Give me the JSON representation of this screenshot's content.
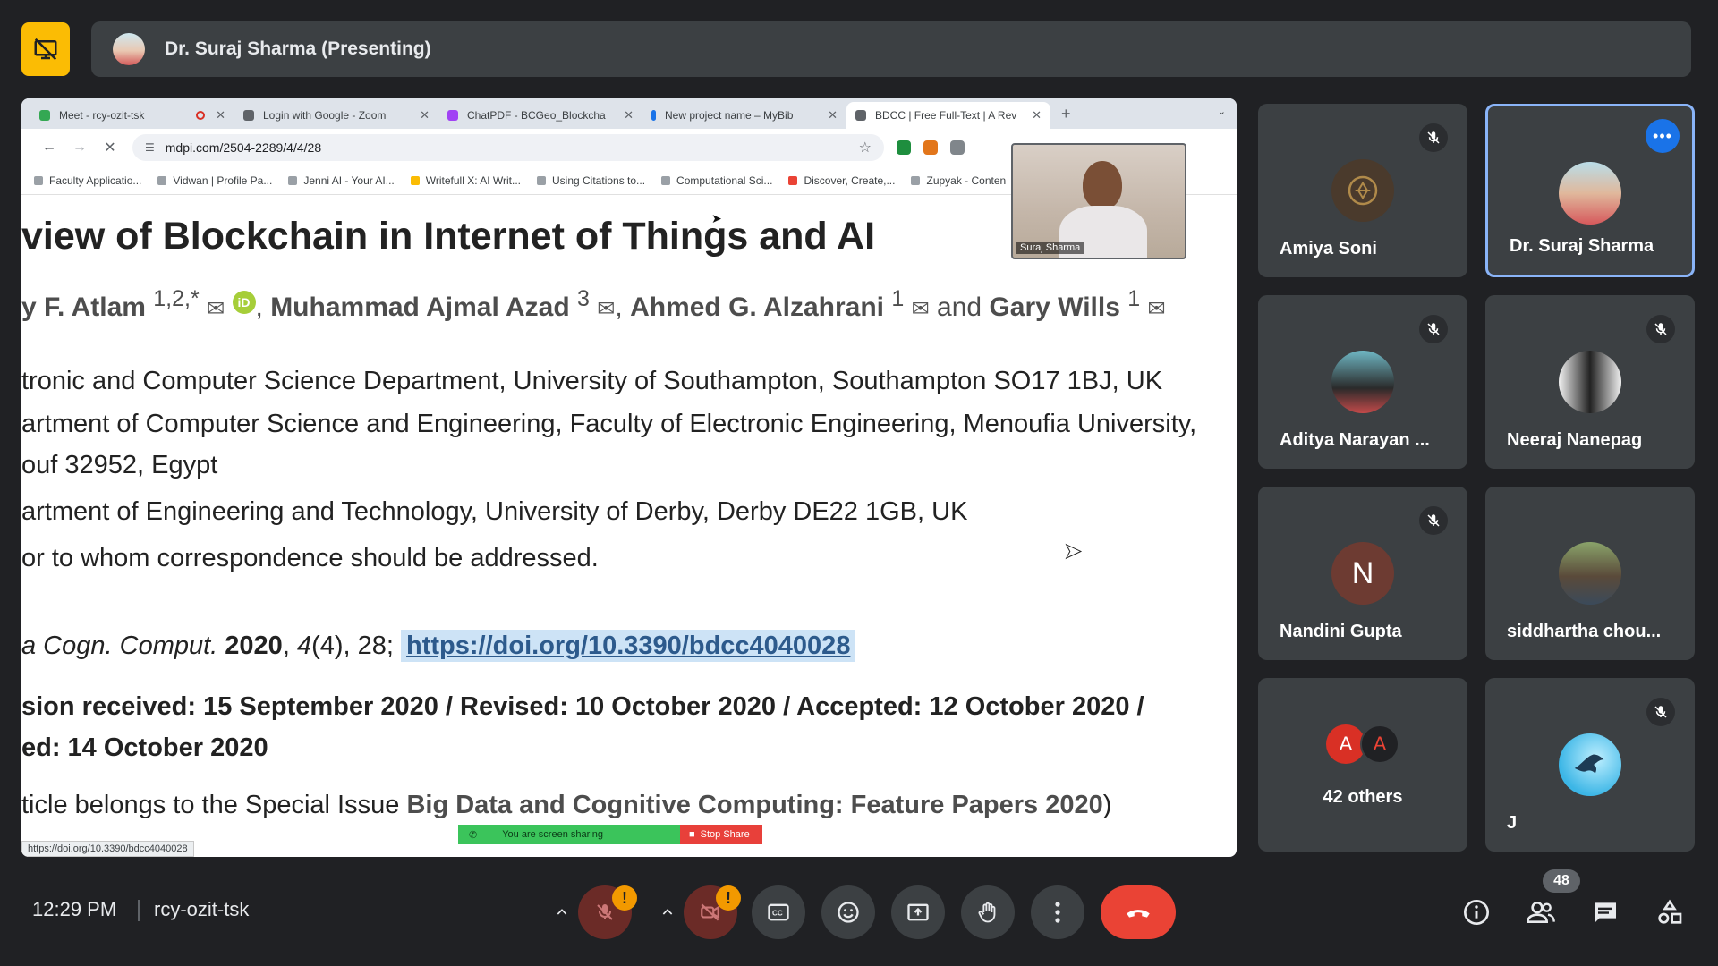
{
  "presenter": {
    "label": "Dr. Suraj Sharma (Presenting)"
  },
  "browser": {
    "tabs": [
      {
        "label": "Meet - rcy-ozit-tsk",
        "color": "#34a853"
      },
      {
        "label": "Login with Google - Zoom",
        "color": "#5f6368"
      },
      {
        "label": "ChatPDF - BCGeo_Blockcha",
        "color": "#a142f4"
      },
      {
        "label": "New project name – MyBib",
        "color": "#1a73e8"
      },
      {
        "label": "BDCC | Free Full-Text | A Rev",
        "color": "#5f6368"
      }
    ],
    "url": "mdpi.com/2504-2289/4/4/28",
    "bookmarks": [
      "Faculty Applicatio...",
      "Vidwan | Profile Pa...",
      "Jenni AI - Your AI...",
      "Writefull X: AI Writ...",
      "Using Citations to...",
      "Computational Sci...",
      "Discover, Create,...",
      "Zupyak - Conten"
    ],
    "status_url": "https://doi.org/10.3390/bdcc4040028",
    "sharing": {
      "message": "You are screen sharing",
      "stop_label": "Stop Share"
    }
  },
  "article": {
    "title": "view of Blockchain in Internet of Things and AI",
    "authors": {
      "a1": "y F. Atlam",
      "a1_sup": "1,2,*",
      "a2": "Muhammad Ajmal Azad",
      "a2_sup": "3",
      "a3": "Ahmed G. Alzahrani",
      "a3_sup": "1",
      "and": "and",
      "a4": "Gary Wills",
      "a4_sup": "1",
      "orcid": "iD"
    },
    "affiliations": [
      "tronic and Computer Science Department, University of Southampton, Southampton SO17 1BJ, UK",
      "artment of Computer Science and Engineering, Faculty of Electronic Engineering, Menoufia University,",
      "ouf 32952, Egypt",
      "artment of Engineering and Technology, University of Derby, Derby DE22 1GB, UK",
      "or to whom correspondence should be addressed."
    ],
    "citation": {
      "journal": "a Cogn. Comput.",
      "year": "2020",
      "volume": "4",
      "issue_pages": "(4), 28;",
      "doi": "https://doi.org/10.3390/bdcc4040028"
    },
    "history1": "sion received: 15 September 2020 / Revised: 10 October 2020 / Accepted: 12 October 2020 /",
    "history2": "ed: 14 October 2020",
    "special_issue_prefix": "ticle belongs to the Special Issue",
    "special_issue_name": "Big Data and Cognitive Computing: Feature Papers 2020",
    "special_issue_suffix": ")"
  },
  "pip": {
    "name": "Suraj Sharma"
  },
  "participants": [
    {
      "name": "Amiya Soni",
      "muted": true
    },
    {
      "name": "Dr. Suraj Sharma",
      "muted": false,
      "active": true
    },
    {
      "name": "Aditya Narayan ...",
      "muted": true
    },
    {
      "name": "Neeraj Nanepag",
      "muted": true
    },
    {
      "name": "Nandini Gupta",
      "muted": true,
      "initial": "N"
    },
    {
      "name": "siddhartha chou...",
      "muted": false
    },
    {
      "name": "42 others",
      "initials": [
        "A",
        "A"
      ]
    },
    {
      "name": "J",
      "muted": true
    }
  ],
  "meeting": {
    "time": "12:29 PM",
    "code": "rcy-ozit-tsk",
    "participant_count": "48"
  },
  "colors": {
    "hangup": "#ea4335",
    "accent": "#8ab4f8",
    "warning": "#f29900",
    "presenting_badge": "#fbbc04"
  }
}
